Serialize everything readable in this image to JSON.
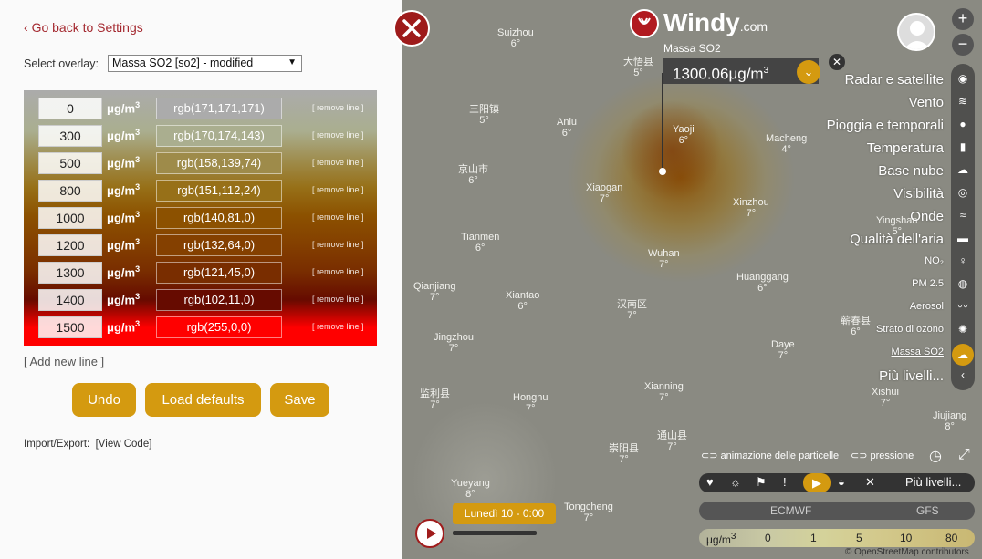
{
  "settings": {
    "back_label": "Go back to Settings",
    "overlay_label": "Select overlay:",
    "overlay_value": "Massa SO2 [so2] - modified",
    "unit": "μg/m",
    "unit_exp": "3",
    "remove_label": "[ remove line ]",
    "rows": [
      {
        "value": "0",
        "rgb": "rgb(171,171,171)"
      },
      {
        "value": "300",
        "rgb": "rgb(170,174,143)"
      },
      {
        "value": "500",
        "rgb": "rgb(158,139,74)"
      },
      {
        "value": "800",
        "rgb": "rgb(151,112,24)"
      },
      {
        "value": "1000",
        "rgb": "rgb(140,81,0)"
      },
      {
        "value": "1200",
        "rgb": "rgb(132,64,0)"
      },
      {
        "value": "1300",
        "rgb": "rgb(121,45,0)"
      },
      {
        "value": "1400",
        "rgb": "rgb(102,11,0)"
      },
      {
        "value": "1500",
        "rgb": "rgb(255,0,0)"
      }
    ],
    "add_line": "[ Add new line ]",
    "undo": "Undo",
    "load_defaults": "Load defaults",
    "save": "Save",
    "import_export": "Import/Export:",
    "view_code": "[View Code]"
  },
  "map": {
    "logo": "Windy",
    "logo_suffix": ".com",
    "pin_overlay": "Massa SO2",
    "pin_value": "1300.06μg/m",
    "pin_unit_exp": "3",
    "cities": [
      {
        "name": "Suizhou",
        "t": "6°"
      },
      {
        "name": "大悟县",
        "t": "5°"
      },
      {
        "name": "三阳镇",
        "t": "5°"
      },
      {
        "name": "Anlu",
        "t": "6°"
      },
      {
        "name": "Yaoji",
        "t": "6°"
      },
      {
        "name": "京山市",
        "t": "6°"
      },
      {
        "name": "Macheng",
        "t": "4°"
      },
      {
        "name": "Xiaogan",
        "t": "7°"
      },
      {
        "name": "Xinzhou",
        "t": "7°"
      },
      {
        "name": "Tianmen",
        "t": "6°"
      },
      {
        "name": "Wuhan",
        "t": "7°"
      },
      {
        "name": "Huanggang",
        "t": "6°"
      },
      {
        "name": "Qianjiang",
        "t": "7°"
      },
      {
        "name": "Xiantao",
        "t": "6°"
      },
      {
        "name": "汉南区",
        "t": "7°"
      },
      {
        "name": "蕲春县",
        "t": "6°"
      },
      {
        "name": "Daye",
        "t": "7°"
      },
      {
        "name": "Jingzhou",
        "t": "7°"
      },
      {
        "name": "监利县",
        "t": "7°"
      },
      {
        "name": "Honghu",
        "t": "7°"
      },
      {
        "name": "Xianning",
        "t": "7°"
      },
      {
        "name": "通山县",
        "t": "7°"
      },
      {
        "name": "崇阳县",
        "t": "7°"
      },
      {
        "name": "Yueyang",
        "t": "8°"
      },
      {
        "name": "Tongcheng",
        "t": "7°"
      },
      {
        "name": "Jiujiang",
        "t": "8°"
      },
      {
        "name": "Yingshan",
        "t": "5°"
      },
      {
        "name": "Xishui",
        "t": "7°"
      }
    ],
    "overlays": [
      "Radar e satellite",
      "Vento",
      "Pioggia e temporali",
      "Temperatura",
      "Base nube",
      "Visibilità",
      "Onde",
      "Qualità dell'aria"
    ],
    "sub_overlays": [
      "NO₂",
      "PM 2.5",
      "Aerosol",
      "Strato di ozono",
      "Massa SO2"
    ],
    "more_levels": "Più livelli...",
    "particles": "animazione delle particelle",
    "pressure": "pressione",
    "more_layers": "Più livelli...",
    "models": [
      "ECMWF",
      "GFS"
    ],
    "legend_unit": "μg/m",
    "legend_values": [
      "0",
      "1",
      "5",
      "10",
      "80"
    ],
    "time": "Lunedì 10 - 0:00",
    "attribution": "© OpenStreetMap contributors"
  }
}
